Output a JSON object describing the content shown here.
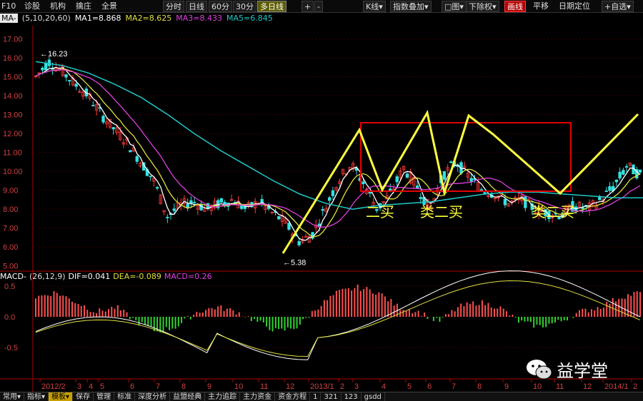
{
  "toolbar": {
    "left": [
      "F10",
      "诊股",
      "机构",
      "擒庄",
      "全景"
    ],
    "periods": [
      "分时",
      "日线",
      "60分",
      "30分",
      "多日线"
    ],
    "active_period": "多日线",
    "nav": [
      "+",
      "-"
    ],
    "right_menus": [
      "K线▾",
      "指数叠加▾",
      "□图▾",
      "下除权▾"
    ],
    "highlight": "画线",
    "right_items": [
      "平移",
      "日期定位",
      "+自选▾"
    ]
  },
  "indicator_line": {
    "name": "MA-",
    "params": "(5,10,20,60)",
    "ma1": "MA1=8.868",
    "ma2": "MA2=8.625",
    "ma3": "MA3=8.433",
    "ma5": "MA5=6.845"
  },
  "macd_line": {
    "name": "MACD-",
    "params": "(26,12,9)",
    "dif": "DIF=0.041",
    "dea": "DEA=-0.089",
    "macd": "MACD=0.26"
  },
  "colors": {
    "up": "#ff3b3b",
    "down": "#35e0e0",
    "ma1": "#ffffff",
    "ma2": "#e0e040",
    "ma3": "#e040e0",
    "ma5": "#20c8c8",
    "annot": "#ffff40",
    "box": "#e00000",
    "hist_up": "#ff5050",
    "hist_down": "#30d030"
  },
  "chart_data": {
    "type": "candlestick",
    "price_axis_ticks": [
      "17.00",
      "16.00",
      "15.00",
      "14.00",
      "13.00",
      "12.00",
      "11.00",
      "10.00",
      "9.00",
      "8.00",
      "7.00",
      "6.00",
      "5.00"
    ],
    "macd_axis_ticks": [
      "0.5",
      "0.0",
      "-0.5"
    ],
    "x_ticks": [
      "2012/2",
      "3",
      "4",
      "5",
      "6",
      "7",
      "8",
      "9",
      "10",
      "11",
      "12",
      "2013/1",
      "2",
      "3",
      "4",
      "5",
      "6",
      "7",
      "8",
      "9",
      "10",
      "11",
      "12",
      "2014/1",
      "2"
    ],
    "price_labels": {
      "high": "16.23",
      "low": "5.38"
    },
    "annotations": [
      "二买",
      "类二买",
      "类二买"
    ],
    "ma5_path": [
      [
        0,
        15.8
      ],
      [
        2,
        15.6
      ],
      [
        4,
        15.2
      ],
      [
        6,
        14.6
      ],
      [
        8,
        13.9
      ],
      [
        10,
        13.0
      ],
      [
        12,
        12.0
      ],
      [
        14,
        11.1
      ],
      [
        16,
        10.3
      ],
      [
        18,
        9.5
      ],
      [
        20,
        8.8
      ],
      [
        22,
        8.3
      ],
      [
        24,
        8.0
      ],
      [
        25,
        8.1
      ],
      [
        26,
        8.2
      ],
      [
        28,
        8.3
      ],
      [
        30,
        8.4
      ],
      [
        32,
        8.6
      ],
      [
        34,
        8.8
      ],
      [
        36,
        8.9
      ],
      [
        38,
        8.9
      ],
      [
        40,
        8.8
      ],
      [
        42,
        8.7
      ],
      [
        44,
        8.6
      ],
      [
        46,
        8.6
      ]
    ],
    "price_path": [
      [
        0,
        15.0
      ],
      [
        1,
        15.8
      ],
      [
        2,
        15.3
      ],
      [
        3,
        14.6
      ],
      [
        4,
        14.0
      ],
      [
        5,
        13.0
      ],
      [
        6,
        12.2
      ],
      [
        7,
        11.5
      ],
      [
        8,
        10.5
      ],
      [
        9,
        9.5
      ],
      [
        10,
        7.6
      ],
      [
        11,
        8.2
      ],
      [
        12,
        8.4
      ],
      [
        13,
        8.0
      ],
      [
        14,
        8.3
      ],
      [
        15,
        8.5
      ],
      [
        16,
        8.0
      ],
      [
        17,
        8.4
      ],
      [
        18,
        7.8
      ],
      [
        19,
        7.3
      ],
      [
        20,
        6.3
      ],
      [
        21,
        6.6
      ],
      [
        22,
        8.0
      ],
      [
        23,
        9.5
      ],
      [
        24,
        10.4
      ],
      [
        25,
        9.3
      ],
      [
        26,
        8.0
      ],
      [
        27,
        8.8
      ],
      [
        28,
        10.2
      ],
      [
        29,
        9.2
      ],
      [
        30,
        8.0
      ],
      [
        31,
        9.8
      ],
      [
        32,
        10.5
      ],
      [
        33,
        9.7
      ],
      [
        34,
        9.0
      ],
      [
        35,
        8.8
      ],
      [
        36,
        8.3
      ],
      [
        37,
        8.5
      ],
      [
        38,
        8.0
      ],
      [
        39,
        7.8
      ],
      [
        40,
        7.7
      ],
      [
        41,
        8.2
      ],
      [
        42,
        8.0
      ],
      [
        43,
        8.5
      ],
      [
        44,
        9.2
      ],
      [
        45,
        10.3
      ],
      [
        46,
        9.8
      ]
    ],
    "macd_hist": [
      0.4,
      0.5,
      0.3,
      0.1,
      0.2,
      -0.1,
      -0.3,
      -0.2,
      0.1,
      0.2,
      0.1,
      -0.1,
      -0.3,
      -0.2,
      0.2,
      0.5,
      0.6,
      0.5,
      0.2,
      0.1,
      -0.1,
      0.2,
      0.3,
      0.2,
      -0.1,
      -0.2,
      -0.1,
      0.1,
      0.2,
      0.4,
      0.5
    ]
  },
  "bottom_tabs": [
    "常用▾",
    "指标▾",
    "模板▾",
    "保存",
    "管理",
    "标准",
    "深度分析",
    "益盟经典",
    "主力追踪",
    "主力资金",
    "资金方程",
    "1",
    "321",
    "123",
    "gsdd"
  ],
  "selected_tab": "模板▾",
  "watermark": "益学堂"
}
